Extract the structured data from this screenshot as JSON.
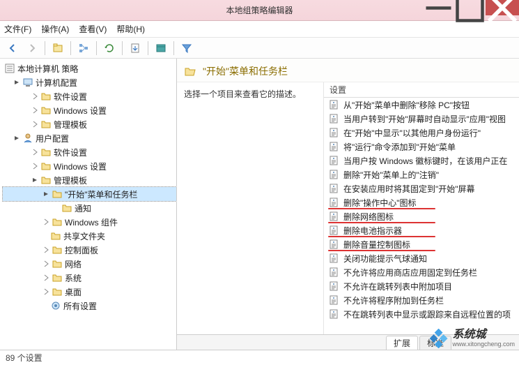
{
  "window": {
    "title": "本地组策略编辑器"
  },
  "menu": {
    "file": "文件(F)",
    "action": "操作(A)",
    "view": "查看(V)",
    "help": "帮助(H)"
  },
  "tree": {
    "root": "本地计算机 策略",
    "computer_config": "计算机配置",
    "software_settings1": "软件设置",
    "windows_settings1": "Windows 设置",
    "admin_templates1": "管理模板",
    "user_config": "用户配置",
    "software_settings2": "软件设置",
    "windows_settings2": "Windows 设置",
    "admin_templates2": "管理模板",
    "start_taskbar": "\"开始\"菜单和任务栏",
    "notifications": "通知",
    "windows_components": "Windows 组件",
    "shared_folders": "共享文件夹",
    "control_panel": "控制面板",
    "network": "网络",
    "system": "系统",
    "desktop": "桌面",
    "all_settings": "所有设置"
  },
  "right": {
    "header": "\"开始\"菜单和任务栏",
    "desc": "选择一个项目来查看它的描述。",
    "col_header": "设置",
    "items": [
      "从\"开始\"菜单中删除\"移除 PC\"按钮",
      "当用户转到\"开始\"屏幕时自动显示\"应用\"视图",
      "在\"开始\"中显示\"以其他用户身份运行\"",
      "将\"运行\"命令添加到\"开始\"菜单",
      "当用户按 Windows 徽标键时，在该用户正在",
      "删除\"开始\"菜单上的\"注销\"",
      "在安装应用时将其固定到\"开始\"屏幕",
      "删除\"操作中心\"图标",
      "删除网络图标",
      "删除电池指示器",
      "删除音量控制图标",
      "关闭功能提示气球通知",
      "不允许将应用商店应用固定到任务栏",
      "不允许在跳转列表中附加项目",
      "不允许将程序附加到任务栏",
      "不在跳转列表中显示或跟踪来自远程位置的项"
    ],
    "underlined_indices": [
      7,
      8,
      9,
      10
    ]
  },
  "tabs": {
    "extended": "扩展",
    "standard": "标准"
  },
  "status": {
    "text": "89 个设置"
  },
  "watermark": {
    "brand": "系统城",
    "url": "www.xitongcheng.com"
  }
}
